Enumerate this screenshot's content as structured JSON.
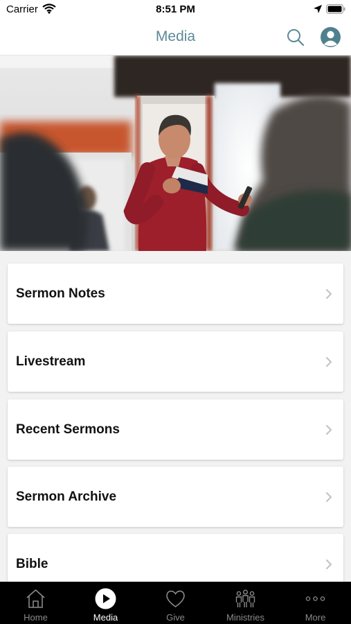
{
  "status_bar": {
    "carrier": "Carrier",
    "time": "8:51 PM"
  },
  "nav": {
    "title": "Media"
  },
  "hero": {
    "icon": "sermon-photo"
  },
  "menu": [
    {
      "label": "Sermon Notes"
    },
    {
      "label": "Livestream"
    },
    {
      "label": "Recent Sermons"
    },
    {
      "label": "Sermon Archive"
    },
    {
      "label": "Bible"
    }
  ],
  "tabs": [
    {
      "label": "Home",
      "icon": "home-icon"
    },
    {
      "label": "Media",
      "icon": "play-icon",
      "active": true
    },
    {
      "label": "Give",
      "icon": "heart-icon"
    },
    {
      "label": "Ministries",
      "icon": "people-icon"
    },
    {
      "label": "More",
      "icon": "more-icon"
    }
  ],
  "colors": {
    "title": "#5b8a96",
    "tab_bg": "#000000",
    "tab_active": "#ffffff",
    "tab_inactive": "#8a8a8a"
  }
}
